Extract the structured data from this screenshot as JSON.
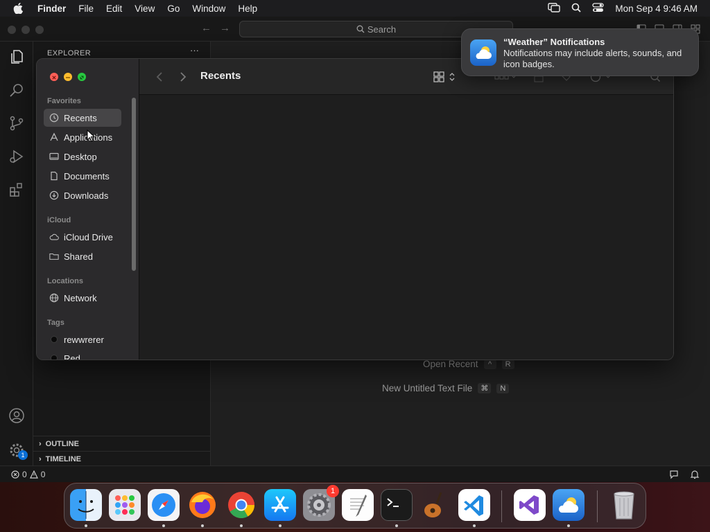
{
  "menubar": {
    "app_name": "Finder",
    "menus": [
      "File",
      "Edit",
      "View",
      "Go",
      "Window",
      "Help"
    ],
    "clock": "Mon Sep 4  9:46 AM"
  },
  "vscode": {
    "search_placeholder": "Search",
    "explorer_title": "EXPLORER",
    "more_actions": "···",
    "sections": [
      "OUTLINE",
      "TIMELINE"
    ],
    "shortcuts": [
      {
        "label": "Open Recent",
        "keys": [
          "^",
          "R"
        ]
      },
      {
        "label": "New Untitled Text File",
        "keys": [
          "⌘",
          "N"
        ]
      }
    ],
    "status": {
      "errors": "0",
      "warnings": "0"
    },
    "settings_badge": "1"
  },
  "finder": {
    "title": "Recents",
    "groups": {
      "favorites": "Favorites",
      "icloud": "iCloud",
      "locations": "Locations",
      "tags": "Tags"
    },
    "favorites": [
      "Recents",
      "Applications",
      "Desktop",
      "Documents",
      "Downloads"
    ],
    "icloud_items": [
      "iCloud Drive",
      "Shared"
    ],
    "locations_items": [
      "Network"
    ],
    "tags_items": [
      "rewwrerer",
      "Red"
    ],
    "selected": "Recents"
  },
  "notification": {
    "title": "“Weather” Notifications",
    "body": "Notifications may include alerts, sounds, and icon badges."
  },
  "dock": {
    "apps": [
      "finder",
      "launchpad",
      "safari",
      "firefox",
      "chrome",
      "app-store",
      "system-settings",
      "textedit",
      "terminal",
      "garageband",
      "vscode",
      "visual-studio",
      "weather",
      "trash"
    ],
    "system_settings_badge": "1"
  },
  "colors": {
    "close": "#ff5f57",
    "minimize": "#febc2e",
    "zoom": "#28c840",
    "badge": "#ff3b30"
  }
}
